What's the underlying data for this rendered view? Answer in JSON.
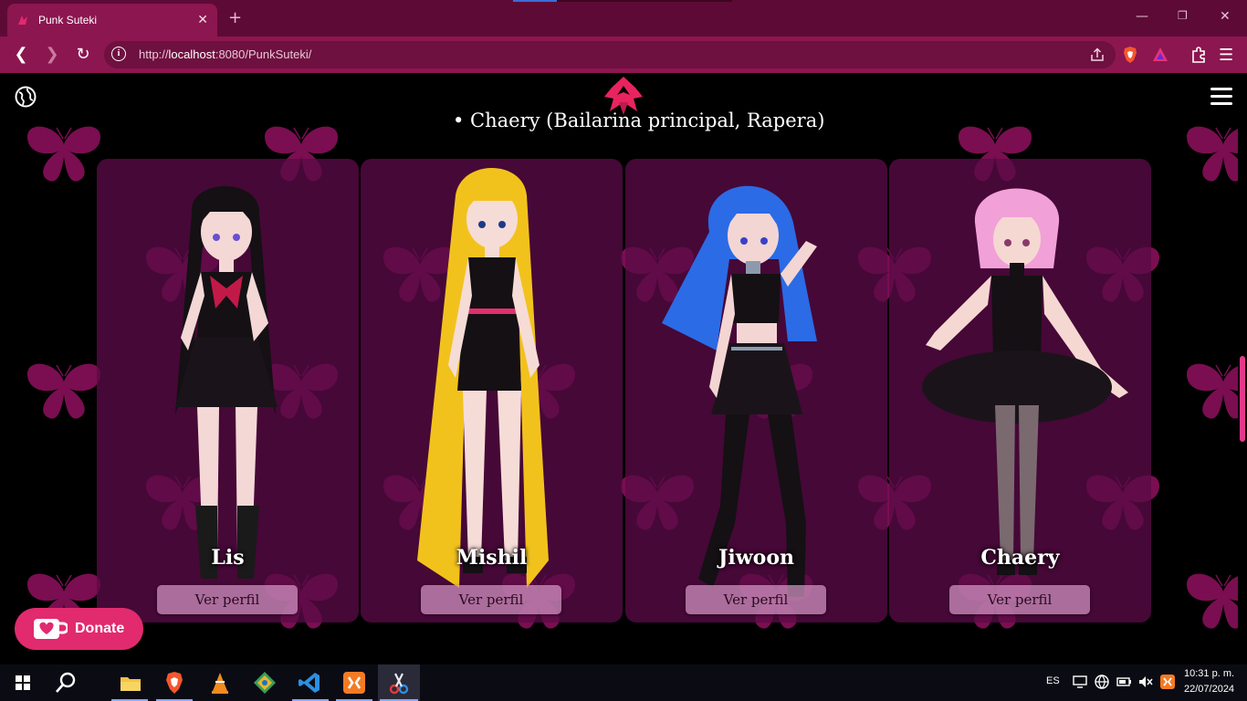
{
  "browser": {
    "tab_title": "Punk Suteki",
    "tab_close": "✕",
    "new_tab": "+",
    "url_prefix": "http://",
    "url_host": "localhost",
    "url_rest": ":8080/PunkSuteki/",
    "window_min": "—",
    "window_max": "❐",
    "window_close": "✕",
    "back": "❮",
    "forward": "❯",
    "reload": "↻",
    "menu": "☰"
  },
  "page": {
    "member_line": "• Chaery (Bailarina principal, Rapera)",
    "cards": [
      {
        "name": "Lis",
        "button": "Ver perfil",
        "hair": "#141014",
        "skin": "#f3d8d6",
        "accent": "#c21a48"
      },
      {
        "name": "Mishil",
        "button": "Ver perfil",
        "hair": "#f2c21c",
        "skin": "#f6dcd6",
        "accent": "#e0306e"
      },
      {
        "name": "Jiwoon",
        "button": "Ver perfil",
        "hair": "#2b6be6",
        "skin": "#f3d6d3",
        "accent": "#8d9aae"
      },
      {
        "name": "Chaery",
        "button": "Ver perfil",
        "hair": "#f2a0d8",
        "skin": "#f5d8d2",
        "accent": "#3a3a3a"
      }
    ],
    "donate_label": "Donate"
  },
  "taskbar": {
    "lang": "ES",
    "time": "10:31 p. m.",
    "date": "22/07/2024"
  },
  "colors": {
    "brand": "#e22a6e",
    "tab_bg": "#5e0a36",
    "chrome": "#8c1650",
    "card": "#5a0a46",
    "butterfly": "#7a0e50"
  }
}
